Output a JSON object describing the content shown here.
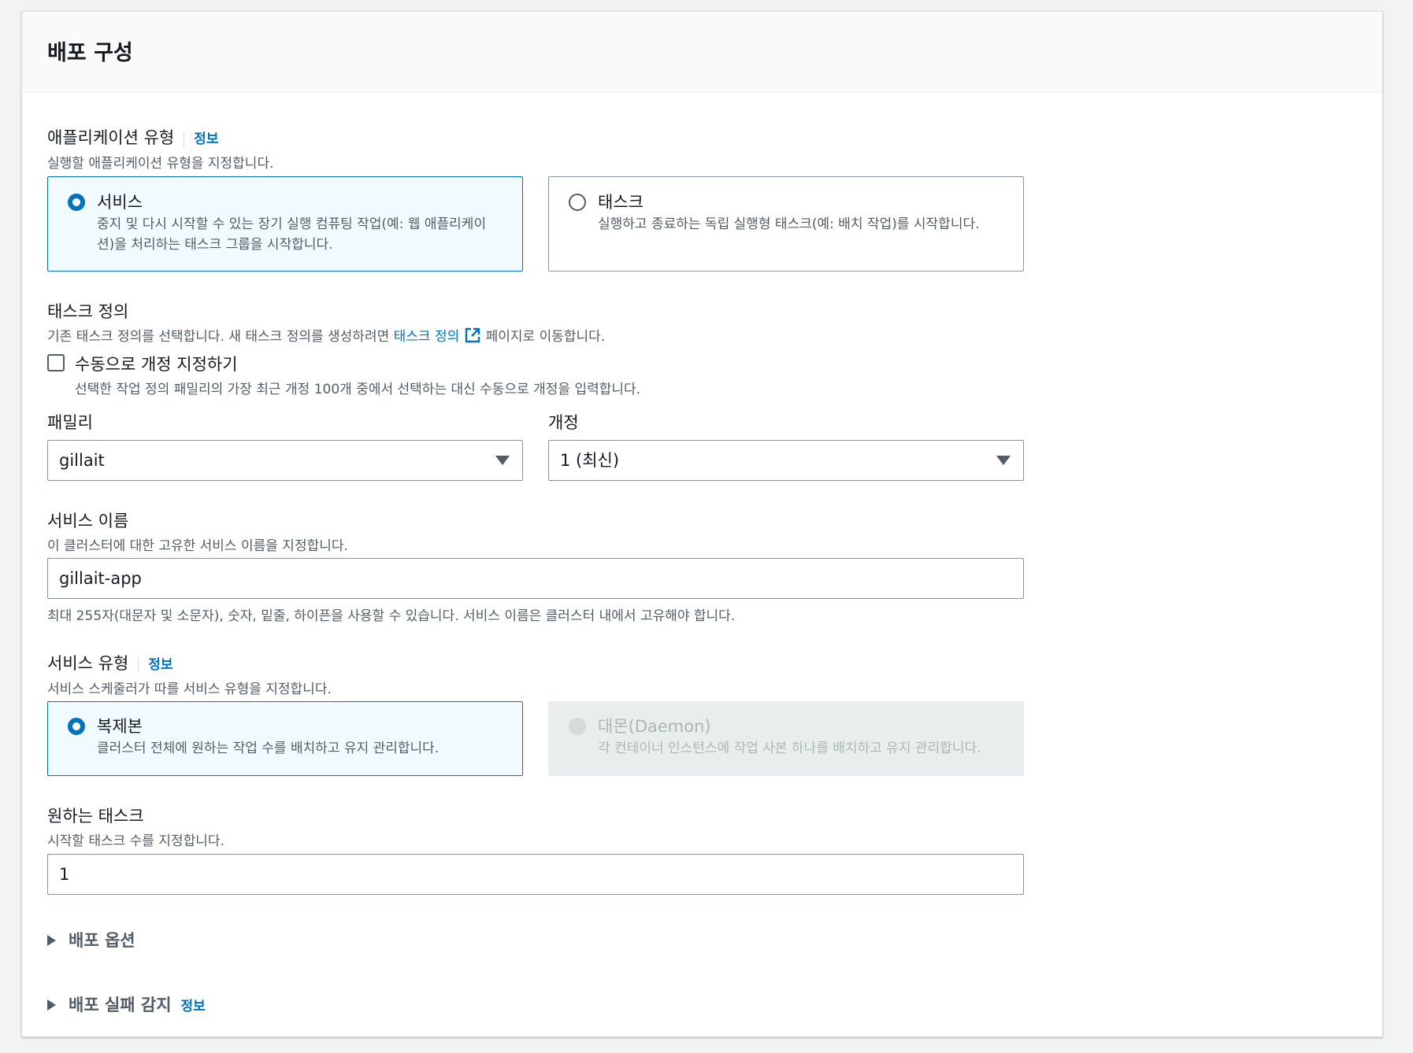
{
  "panel": {
    "title": "배포 구성"
  },
  "app_type": {
    "label": "애플리케이션 유형",
    "info": "정보",
    "description": "실행할 애플리케이션 유형을 지정합니다.",
    "options": [
      {
        "title": "서비스",
        "description_line1": "중지 및 다시 시작할 수 있는 장기 실행 컴퓨팅 작업(예: 웹 애플리케이",
        "description_line2": "션)을 처리하는 태스크 그룹을 시작합니다.",
        "selected": true
      },
      {
        "title": "태스크",
        "description_line1": "실행하고 종료하는 독립 실행형 태스크(예: 배치 작업)를 시작합니다.",
        "selected": false
      }
    ]
  },
  "task_definition": {
    "label": "태스크 정의",
    "description_before": "기존 태스크 정의를 선택합니다. 새 태스크 정의를 생성하려면 ",
    "link_text": "태스크 정의",
    "description_after": " 페이지로 이동합니다.",
    "manual_checkbox": {
      "label": "수동으로 개정 지정하기",
      "description": "선택한 작업 정의 패밀리의 가장 최근 개정 100개 중에서 선택하는 대신 수동으로 개정을 입력합니다.",
      "checked": false
    },
    "family": {
      "label": "패밀리",
      "value": "gillait"
    },
    "revision": {
      "label": "개정",
      "value": "1 (최신)"
    }
  },
  "service_name": {
    "label": "서비스 이름",
    "description": "이 클러스터에 대한 고유한 서비스 이름을 지정합니다.",
    "value": "gillait-app",
    "constraint": "최대 255자(대문자 및 소문자), 숫자, 밑줄, 하이픈을 사용할 수 있습니다. 서비스 이름은 클러스터 내에서 고유해야 합니다."
  },
  "service_type": {
    "label": "서비스 유형",
    "info": "정보",
    "description": "서비스 스케줄러가 따를 서비스 유형을 지정합니다.",
    "options": [
      {
        "title": "복제본",
        "description": "클러스터 전체에 원하는 작업 수를 배치하고 유지 관리합니다.",
        "selected": true,
        "disabled": false
      },
      {
        "title": "대몬(Daemon)",
        "description": "각 컨테이너 인스턴스에 작업 사본 하나를 배치하고 유지 관리합니다.",
        "selected": false,
        "disabled": true
      }
    ]
  },
  "desired_tasks": {
    "label": "원하는 태스크",
    "description": "시작할 태스크 수를 지정합니다.",
    "value": "1"
  },
  "expanders": {
    "deployment_options": "배포 옵션",
    "failure_detection": "배포 실패 감지",
    "failure_detection_info": "정보"
  },
  "colors": {
    "link": "#0073bb",
    "selected_bg": "#f1faff",
    "border": "#879596"
  }
}
